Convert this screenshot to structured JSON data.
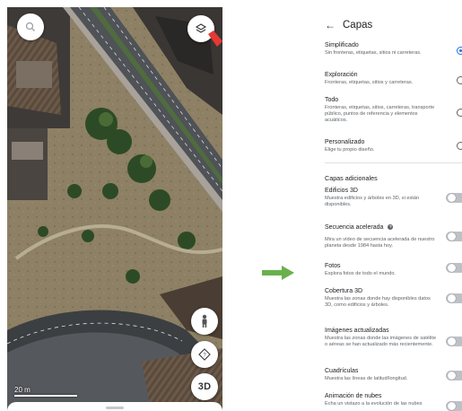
{
  "map": {
    "scale_label": "20 m",
    "three_d_label": "3D",
    "icons": {
      "search": "search-icon",
      "layers": "layers-icon",
      "pegman": "pegman-icon",
      "compass": "compass-icon"
    },
    "highlight_color": "#e53935"
  },
  "panel": {
    "title": "Capas",
    "map_types": [
      {
        "title": "Simplificado",
        "desc": "Sin fronteras, etiquetas, sitios ni carreteras.",
        "selected": true
      },
      {
        "title": "Exploración",
        "desc": "Fronteras, etiquetas, sitios y carreteras.",
        "selected": false
      },
      {
        "title": "Todo",
        "desc": "Fronteras, etiquetas, sitios, carreteras, transporte público, puntos de referencia y elementos acuáticos.",
        "selected": false
      },
      {
        "title": "Personalizado",
        "desc": "Elige tu propio diseño.",
        "selected": false
      }
    ],
    "additional_title": "Capas adicionales",
    "additional_layers": [
      {
        "title": "Edificios 3D",
        "desc": "Muestra edificios y árboles en 3D, si están disponibles.",
        "enabled": false
      },
      {
        "title": "Secuencia acelerada",
        "desc": "Mira un vídeo de secuencia acelerada de nuestro planeta desde 1984 hasta hoy.",
        "enabled": false,
        "help": "?"
      },
      {
        "title": "Fotos",
        "desc": "Explora fotos de todo el mundo.",
        "enabled": false
      },
      {
        "title": "Cobertura 3D",
        "desc": "Muestra las zonas donde hay disponibles datos 3D, como edificios y árboles.",
        "enabled": false
      },
      {
        "title": "Imágenes actualizadas",
        "desc": "Muestra las zonas donde las imágenes de satélite o aéreas se han actualizado más recientemente.",
        "enabled": false
      },
      {
        "title": "Cuadrículas",
        "desc": "Muestra las líneas de latitud/longitud.",
        "enabled": false
      },
      {
        "title": "Animación de nubes",
        "desc": "Echa un vistazo a la evolución de las nubes",
        "enabled": false
      }
    ],
    "accent_color": "#1a73e8"
  },
  "arrow_color": "#6ab04c"
}
